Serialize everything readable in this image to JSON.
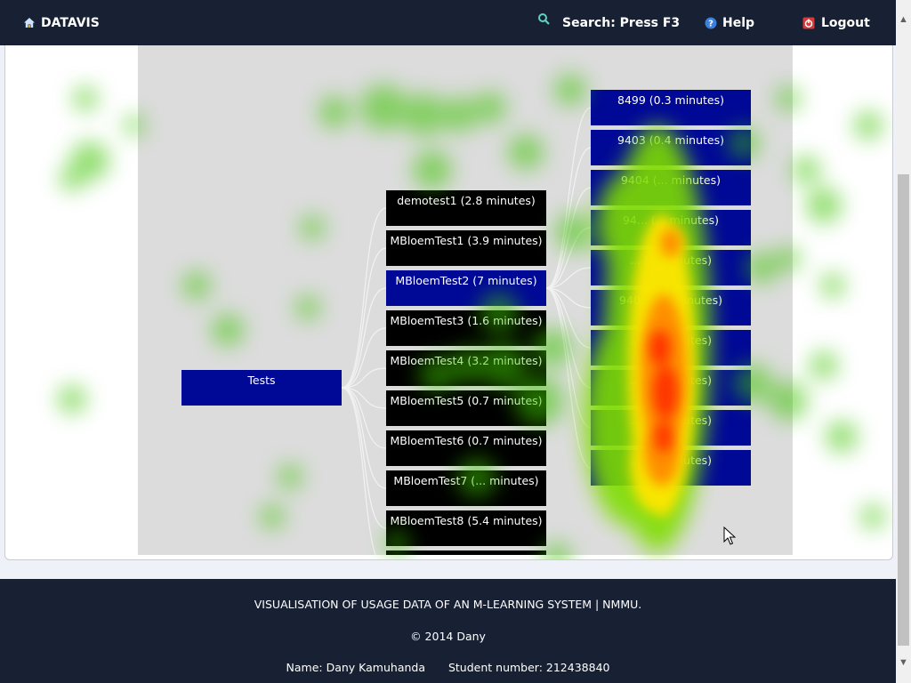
{
  "nav": {
    "brand": "DATAVIS",
    "search_label": "Search: Press F3",
    "help_label": "Help",
    "logout_label": "Logout"
  },
  "tree": {
    "root": "Tests",
    "tests": [
      "demotest1 (2.8 minutes)",
      "MBloemTest1 (3.9 minutes)",
      "MBloemTest2 (7 minutes)",
      "MBloemTest3 (1.6 minutes)",
      "MBloemTest4 (3.2 minutes)",
      "MBloemTest5 (0.7 minutes)",
      "MBloemTest6 (0.7 minutes)",
      "MBloemTest7 (... minutes)",
      "MBloemTest8 (5.4 minutes)"
    ],
    "students": [
      "8499 (0.3 minutes)",
      "9403 (0.4 minutes)",
      "9404 (... minutes)",
      "94... (... minutes)",
      "... (... minutes)",
      "940... (... minutes)",
      "... (... minutes)",
      "... (... minutes)",
      "... (... minutes)",
      "... (... minutes)"
    ]
  },
  "footer": {
    "title": "VISUALISATION OF USAGE DATA OF AN M-LEARNING SYSTEM | NMMU.",
    "copyright": "© 2014 Dany",
    "name": "Name: Dany Kamuhanda",
    "student_number": "Student number: 212438840"
  },
  "colors": {
    "nav_bg": "#172133",
    "node_selected": "#000896",
    "node_default": "#000000",
    "vis_bg": "#dcdcdc"
  }
}
